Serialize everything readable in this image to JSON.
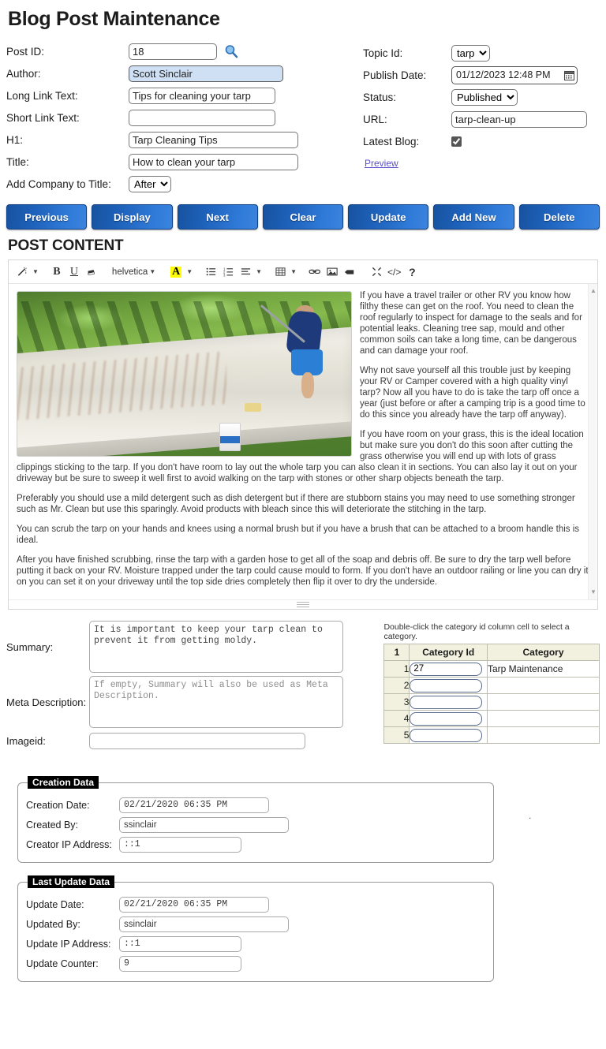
{
  "page": {
    "title": "Blog Post Maintenance",
    "section_title": "POST CONTENT"
  },
  "form": {
    "left": [
      {
        "label": "Post ID:",
        "value": "18"
      },
      {
        "label": "Author:",
        "value": "Scott Sinclair"
      },
      {
        "label": "Long Link Text:",
        "value": "Tips for cleaning your tarp"
      },
      {
        "label": "Short Link Text:",
        "value": ""
      },
      {
        "label": "H1:",
        "value": "Tarp Cleaning Tips"
      },
      {
        "label": "Title:",
        "value": "How to clean your tarp"
      },
      {
        "label": "Add Company to Title:",
        "value": "After"
      }
    ],
    "right": {
      "topic_label": "Topic Id:",
      "topic_value": "tarp",
      "publish_label": "Publish Date:",
      "publish_value": "01/12/2023 12:48 PM",
      "status_label": "Status:",
      "status_value": "Published",
      "url_label": "URL:",
      "url_value": "tarp-clean-up",
      "latest_label": "Latest Blog:",
      "latest_checked": "true",
      "preview_link": "Preview"
    },
    "search_icon": "search-icon",
    "calendar_icon": "calendar-icon"
  },
  "buttons": [
    "Previous",
    "Display",
    "Next",
    "Clear",
    "Update",
    "Add New",
    "Delete"
  ],
  "editor": {
    "toolbar": {
      "magic_wand": "magic-wand-icon",
      "bold": "B",
      "underline": "U",
      "remove_format": "eraser-icon",
      "font_name": "helvetica",
      "font_color": "A",
      "bullet_list": "bullet-list-icon",
      "numbered_list": "numbered-list-icon",
      "align": "align-icon",
      "table": "table-icon",
      "link": "link-icon",
      "image": "image-icon",
      "video": "video-icon",
      "fullscreen": "fullscreen-icon",
      "code_view": "</>",
      "help": "?"
    },
    "image_alt": "Man scrubbing a large white tarp laid out on a grassy lawn",
    "paragraphs": [
      "If you have a travel trailer or other RV you know how filthy these can get on the roof. You need to clean the roof regularly to inspect for damage to the seals and for potential leaks. Cleaning tree sap, mould and other common soils can take a long time, can be dangerous and can damage your roof.",
      "Why not save yourself all this trouble just by keeping your RV or Camper covered with a high quality vinyl tarp? Now all you have to do is take the tarp off once a year (just before or after a camping trip is a good time to do this since you already have the tarp off anyway).",
      "If you have room on your grass, this is the ideal location but make sure you don't do this soon after cutting the grass otherwise you will end up with lots of grass clippings sticking to the tarp. If you don't have room to lay out the whole tarp you can also clean it in sections. You can also lay it out on your driveway but be sure to sweep it well first to avoid walking on the tarp with stones or other sharp objects beneath the tarp.",
      "Preferably you should use a mild detergent such as dish detergent but if there are stubborn stains you may need to use something stronger such as Mr. Clean but use this sparingly. Avoid products with bleach since this will deteriorate the stitching in the tarp.",
      "You can scrub the tarp on your hands and knees using a normal brush but if you have a brush that can be attached to a broom handle this is ideal.",
      "After you have finished scrubbing, rinse the tarp with a garden hose to get all of the soap and debris off. Be sure to dry the tarp well before putting it back on your RV. Moisture trapped under the tarp could cause mould to form. If you don't have an outdoor railing or line you can dry it on you can set it on your driveway until the top side dries completely then flip it over to dry the underside."
    ]
  },
  "summary": {
    "label": "Summary:",
    "value": "It is important to keep your tarp clean to prevent it from getting moldy."
  },
  "meta_description": {
    "label": "Meta Description:",
    "value": "",
    "placeholder": "If empty, Summary will also be used as Meta Description."
  },
  "imageid": {
    "label": "Imageid:",
    "value": ""
  },
  "categories": {
    "hint": "Double-click the category id column cell to select a category.",
    "headers": [
      "1",
      "Category Id",
      "Category"
    ],
    "rows": [
      {
        "num": "1",
        "id": "27",
        "category": "Tarp Maintenance"
      },
      {
        "num": "2",
        "id": "",
        "category": ""
      },
      {
        "num": "3",
        "id": "",
        "category": ""
      },
      {
        "num": "4",
        "id": "",
        "category": ""
      },
      {
        "num": "5",
        "id": "",
        "category": ""
      }
    ]
  },
  "creation_data": {
    "legend": "Creation Data",
    "date_label": "Creation Date:",
    "date_value": "02/21/2020 06:35 PM",
    "by_label": "Created By:",
    "by_value": "ssinclair",
    "ip_label": "Creator IP Address:",
    "ip_value": "::1"
  },
  "update_data": {
    "legend": "Last Update Data",
    "date_label": "Update Date:",
    "date_value": "02/21/2020 06:35 PM",
    "by_label": "Updated By:",
    "by_value": "ssinclair",
    "ip_label": "Update IP Address:",
    "ip_value": "::1",
    "counter_label": "Update Counter:",
    "counter_value": "9"
  },
  "colors": {
    "button_blue_dark": "#17529f",
    "button_blue_light": "#3b84de",
    "selected_field": "#cfe0f5",
    "highlight_yellow": "#ffff00",
    "link": "#5a4fcf",
    "table_header": "#f2f1e0"
  }
}
